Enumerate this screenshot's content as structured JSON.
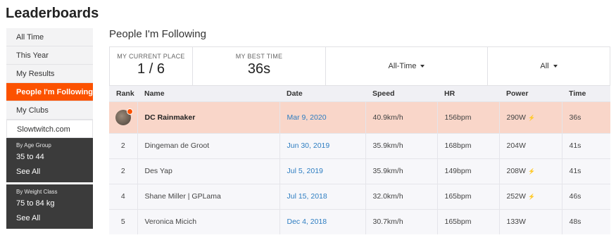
{
  "title": "Leaderboards",
  "sidebar": {
    "items": [
      {
        "label": "All Time"
      },
      {
        "label": "This Year"
      },
      {
        "label": "My Results"
      },
      {
        "label": "People I'm Following"
      },
      {
        "label": "My Clubs"
      },
      {
        "label": "Slowtwitch.com"
      }
    ],
    "age_group": {
      "heading": "By Age Group",
      "value": "35 to 44",
      "see_all": "See All"
    },
    "weight_class": {
      "heading": "By Weight Class",
      "value": "75 to 84 kg",
      "see_all": "See All"
    }
  },
  "main": {
    "title": "People I'm Following",
    "stats": {
      "current_place_label": "MY CURRENT PLACE",
      "current_place_value": "1 / 6",
      "best_time_label": "MY BEST TIME",
      "best_time_value": "36s"
    },
    "filters": {
      "time": "All-Time",
      "other": "All"
    },
    "columns": [
      "Rank",
      "Name",
      "Date",
      "Speed",
      "HR",
      "Power",
      "Time"
    ],
    "rows": [
      {
        "rank": "",
        "name": "DC Rainmaker",
        "date": "Mar 9, 2020",
        "speed": "40.9km/h",
        "hr": "156bpm",
        "power": "290W",
        "power_meter": true,
        "time": "36s"
      },
      {
        "rank": "2",
        "name": "Dingeman de Groot",
        "date": "Jun 30, 2019",
        "speed": "35.9km/h",
        "hr": "168bpm",
        "power": "204W",
        "power_meter": false,
        "time": "41s"
      },
      {
        "rank": "2",
        "name": "Des Yap",
        "date": "Jul 5, 2019",
        "speed": "35.9km/h",
        "hr": "149bpm",
        "power": "208W",
        "power_meter": true,
        "time": "41s"
      },
      {
        "rank": "4",
        "name": "Shane Miller | GPLama",
        "date": "Jul 15, 2018",
        "speed": "32.0km/h",
        "hr": "165bpm",
        "power": "252W",
        "power_meter": true,
        "time": "46s"
      },
      {
        "rank": "5",
        "name": "Veronica Micich",
        "date": "Dec 4, 2018",
        "speed": "30.7km/h",
        "hr": "165bpm",
        "power": "133W",
        "power_meter": false,
        "time": "48s"
      }
    ]
  },
  "colors": {
    "accent": "#fc5200",
    "highlight_row": "#f9d6c9",
    "link": "#2d7dc1",
    "sidebar_dark": "#3b3b3b"
  },
  "icons": {
    "power_meter": "power-meter-icon",
    "caret": "chevron-down-icon",
    "avatar_badge": "badge-icon"
  }
}
